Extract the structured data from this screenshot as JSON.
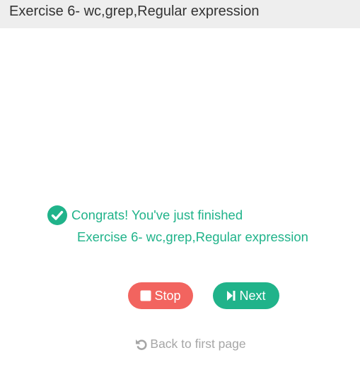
{
  "header": {
    "title": "Exercise 6- wc,grep,Regular expression"
  },
  "completion": {
    "icon": "check-circle-icon",
    "message": "Congrats! You've just finished",
    "exercise_name": "Exercise 6- wc,grep,Regular expression",
    "color": "#20b38a"
  },
  "actions": {
    "stop_label": "Stop",
    "stop_icon": "stop-icon",
    "stop_color": "#f2645f",
    "next_label": "Next",
    "next_icon": "step-forward-icon",
    "next_color": "#20b38a"
  },
  "footer": {
    "back_label": "Back to first page",
    "back_icon": "undo-icon"
  }
}
